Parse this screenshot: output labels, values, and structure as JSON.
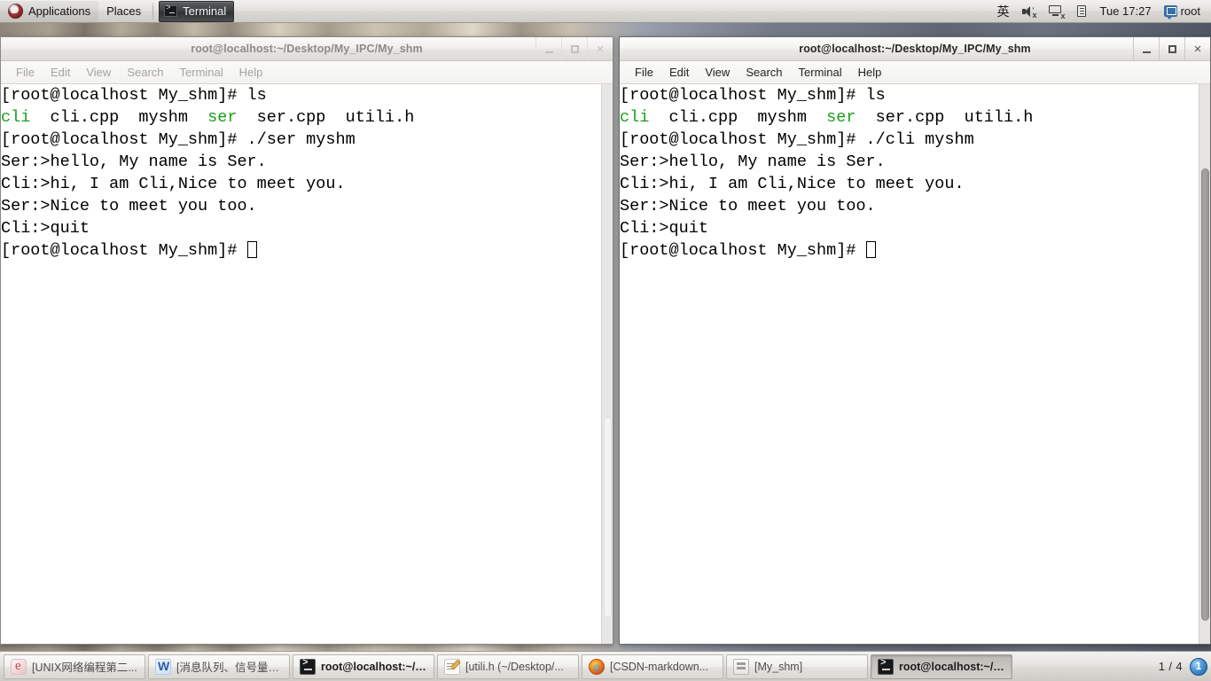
{
  "top_panel": {
    "applications_label": "Applications",
    "places_label": "Places",
    "window_task": {
      "label": "Terminal",
      "icon": "terminal-icon"
    },
    "tray": {
      "input_method": "英",
      "speaker_icon": "speaker-muted-icon",
      "network_icon": "network-disconnected-icon",
      "clipboard_icon": "clipboard-icon",
      "clock": "Tue 17:27",
      "user_icon": "user-icon",
      "user_label": "root"
    }
  },
  "windows": [
    {
      "title": "root@localhost:~/Desktop/My_IPC/My_shm",
      "active": false,
      "menu": [
        "File",
        "Edit",
        "View",
        "Search",
        "Terminal",
        "Help"
      ],
      "buttons": {
        "minimize": "minimize-button",
        "maximize": "maximize-button",
        "close": "close-button"
      },
      "lines": [
        [
          {
            "t": "[root@localhost My_shm]# ls",
            "c": "plain"
          }
        ],
        [
          {
            "t": "cli",
            "c": "green"
          },
          {
            "t": "  cli.cpp  myshm  ",
            "c": "plain"
          },
          {
            "t": "ser",
            "c": "green"
          },
          {
            "t": "  ser.cpp  utili.h",
            "c": "plain"
          }
        ],
        [
          {
            "t": "[root@localhost My_shm]# ./ser myshm",
            "c": "plain"
          }
        ],
        [
          {
            "t": "Ser:>hello, My name is Ser.",
            "c": "plain"
          }
        ],
        [
          {
            "t": "Cli:>hi, I am Cli,Nice to meet you.",
            "c": "plain"
          }
        ],
        [
          {
            "t": "Ser:>Nice to meet you too.",
            "c": "plain"
          }
        ],
        [
          {
            "t": "Cli:>quit",
            "c": "plain"
          }
        ],
        [
          {
            "t": "[root@localhost My_shm]# ",
            "c": "plain"
          },
          {
            "t": "",
            "c": "cursor"
          }
        ]
      ]
    },
    {
      "title": "root@localhost:~/Desktop/My_IPC/My_shm",
      "active": true,
      "menu": [
        "File",
        "Edit",
        "View",
        "Search",
        "Terminal",
        "Help"
      ],
      "buttons": {
        "minimize": "minimize-button",
        "maximize": "maximize-button",
        "close": "close-button"
      },
      "lines": [
        [
          {
            "t": "[root@localhost My_shm]# ls",
            "c": "plain"
          }
        ],
        [
          {
            "t": "cli",
            "c": "green"
          },
          {
            "t": "  cli.cpp  myshm  ",
            "c": "plain"
          },
          {
            "t": "ser",
            "c": "green"
          },
          {
            "t": "  ser.cpp  utili.h",
            "c": "plain"
          }
        ],
        [
          {
            "t": "[root@localhost My_shm]# ./cli myshm",
            "c": "plain"
          }
        ],
        [
          {
            "t": "Ser:>hello, My name is Ser.",
            "c": "plain"
          }
        ],
        [
          {
            "t": "Cli:>hi, I am Cli,Nice to meet you.",
            "c": "plain"
          }
        ],
        [
          {
            "t": "Ser:>Nice to meet you too.",
            "c": "plain"
          }
        ],
        [
          {
            "t": "Cli:>quit",
            "c": "plain"
          }
        ],
        [
          {
            "t": "[root@localhost My_shm]# ",
            "c": "plain"
          },
          {
            "t": "",
            "c": "cursor"
          }
        ]
      ]
    }
  ],
  "taskbar": {
    "items": [
      {
        "label": "[UNIX网络编程第二...",
        "icon": "ebook-icon",
        "state": "normal"
      },
      {
        "label": "[消息队列、信号量、...",
        "icon": "wps-writer-icon",
        "state": "normal"
      },
      {
        "label": "root@localhost:~/D...",
        "icon": "terminal-icon",
        "state": "semi"
      },
      {
        "label": "[utili.h (~/Desktop/...",
        "icon": "text-editor-icon",
        "state": "normal"
      },
      {
        "label": "[CSDN-markdown...",
        "icon": "firefox-icon",
        "state": "normal"
      },
      {
        "label": "[My_shm]",
        "icon": "file-manager-icon",
        "state": "normal"
      },
      {
        "label": "root@localhost:~/D...",
        "icon": "terminal-icon",
        "state": "pressed"
      }
    ],
    "workspace_indicator": "1 / 4",
    "workspace_badge": "1"
  },
  "colors": {
    "terminal_green": "#1a9e1a",
    "terminal_fg": "#000000",
    "terminal_bg": "#ffffff",
    "panel_bg": "#e6e4e0",
    "accent_blue": "#4a95d4"
  }
}
